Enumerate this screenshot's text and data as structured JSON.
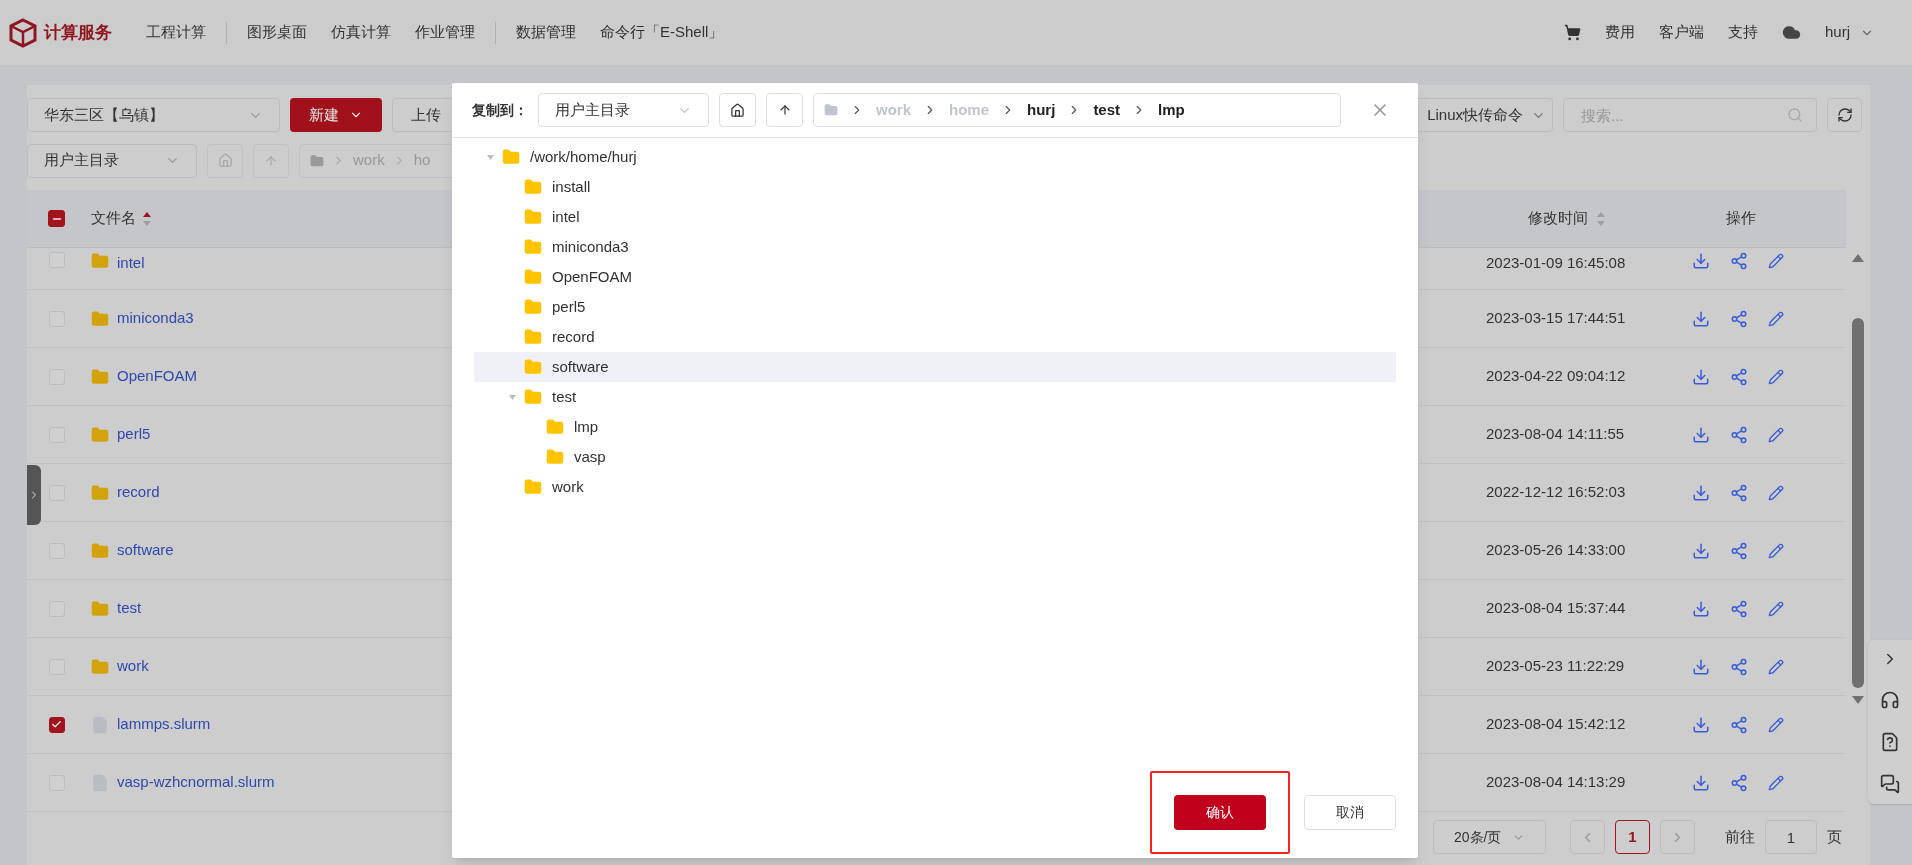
{
  "nav": {
    "brand": "计算服务",
    "groups": [
      [
        "工程计算"
      ],
      [
        "图形桌面",
        "仿真计算",
        "作业管理"
      ],
      [
        "数据管理",
        "命令行「E-Shell」"
      ]
    ],
    "right": [
      "费用",
      "客户端",
      "支持"
    ],
    "user": "hurj"
  },
  "toolbar": {
    "region": "华东三区【乌镇】",
    "new_button": "新建",
    "upload_button": "上传",
    "transfer": "Linux快传命令",
    "search_placeholder": "搜索...",
    "dir_select": "用户主目录",
    "breadcrumb": [
      "work",
      "ho"
    ]
  },
  "table": {
    "header_indeterminate": true,
    "columns": [
      {
        "label": "文件名",
        "sorted": true
      },
      {
        "label": "修改时间",
        "sorted": false
      },
      {
        "label": "操作"
      }
    ],
    "rows": [
      {
        "name": "intel",
        "kind": "folder",
        "checked": false,
        "modified": "2023-01-09 16:45:08"
      },
      {
        "name": "miniconda3",
        "kind": "folder",
        "checked": false,
        "modified": "2023-03-15 17:44:51"
      },
      {
        "name": "OpenFOAM",
        "kind": "folder",
        "checked": false,
        "modified": "2023-04-22 09:04:12"
      },
      {
        "name": "perl5",
        "kind": "folder",
        "checked": false,
        "modified": "2023-08-04 14:11:55"
      },
      {
        "name": "record",
        "kind": "folder",
        "checked": false,
        "modified": "2022-12-12 16:52:03"
      },
      {
        "name": "software",
        "kind": "folder",
        "checked": false,
        "modified": "2023-05-26 14:33:00"
      },
      {
        "name": "test",
        "kind": "folder",
        "checked": false,
        "modified": "2023-08-04 15:37:44"
      },
      {
        "name": "work",
        "kind": "folder",
        "checked": false,
        "modified": "2023-05-23 11:22:29"
      },
      {
        "name": "lammps.slurm",
        "kind": "file",
        "checked": true,
        "modified": "2023-08-04 15:42:12"
      },
      {
        "name": "vasp-wzhcnormal.slurm",
        "kind": "file",
        "checked": false,
        "modified": "2023-08-04 14:13:29"
      }
    ]
  },
  "pagination": {
    "page_size": "20条/页",
    "pages": [
      {
        "label": "1",
        "selected": true
      }
    ],
    "goto_label": "前往",
    "goto_value": "1",
    "goto_suffix": "页"
  },
  "dialog": {
    "label": "复制到：",
    "select": "用户主目录",
    "breadcrumb": [
      {
        "label": "work",
        "active": false
      },
      {
        "label": "home",
        "active": false
      },
      {
        "label": "hurj",
        "active": true
      },
      {
        "label": "test",
        "active": true
      },
      {
        "label": "lmp",
        "active": true
      }
    ],
    "tree": [
      {
        "label": "/work/home/hurj",
        "expanded": true,
        "selected": false,
        "children": [
          {
            "label": "install",
            "selected": false
          },
          {
            "label": "intel",
            "selected": false
          },
          {
            "label": "miniconda3",
            "selected": false
          },
          {
            "label": "OpenFOAM",
            "selected": false
          },
          {
            "label": "perl5",
            "selected": false
          },
          {
            "label": "record",
            "selected": false
          },
          {
            "label": "software",
            "selected": true
          },
          {
            "label": "test",
            "expanded": true,
            "selected": false,
            "children": [
              {
                "label": "lmp",
                "selected": false
              },
              {
                "label": "vasp",
                "selected": false
              }
            ]
          },
          {
            "label": "work",
            "selected": false
          }
        ]
      }
    ],
    "confirm": {
      "label": "确认",
      "annotated": true
    },
    "cancel": "取消"
  }
}
